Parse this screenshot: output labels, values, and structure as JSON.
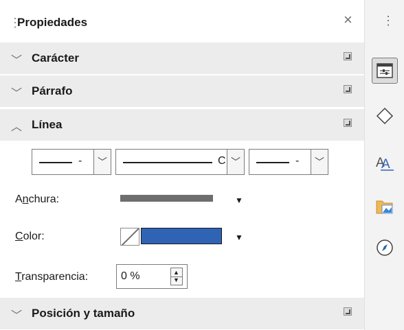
{
  "panel": {
    "title": "Propiedades",
    "close_glyph": "×",
    "grip_glyph": "⋮"
  },
  "sections": {
    "caracter": {
      "label": "Carácter",
      "expanded": false
    },
    "parrafo": {
      "label": "Párrafo",
      "expanded": false
    },
    "linea": {
      "label": "Línea",
      "expanded": true
    },
    "posicion": {
      "label": "Posición y tamaño",
      "expanded": false
    }
  },
  "linea": {
    "style_combo_1": {
      "dash": "-"
    },
    "style_combo_2": {
      "dash": "C"
    },
    "style_combo_3": {
      "dash": "-"
    },
    "anchura_label_pre": "A",
    "anchura_label_underlined": "n",
    "anchura_label_post": "chura:",
    "color_label_underlined": "C",
    "color_label_post": "olor:",
    "color_value": "#2f63b3",
    "transparencia_label_underlined": "T",
    "transparencia_label_post": "ransparencia:",
    "transparencia_value": "0 %"
  },
  "sidebar_tabs": [
    {
      "name": "properties-icon",
      "active": true
    },
    {
      "name": "shapes-icon",
      "active": false
    },
    {
      "name": "styles-icon",
      "active": false
    },
    {
      "name": "gallery-icon",
      "active": false
    },
    {
      "name": "navigator-icon",
      "active": false
    }
  ],
  "colors": {
    "accent": "#2f63b3",
    "section_bg": "#ececec"
  }
}
